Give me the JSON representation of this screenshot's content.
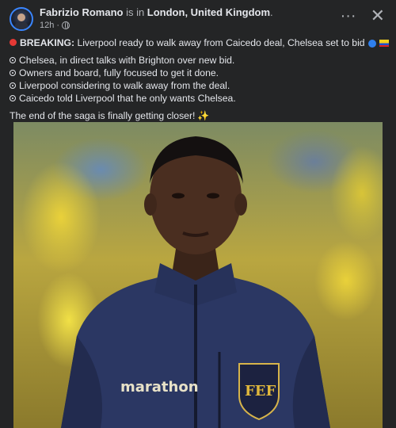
{
  "post": {
    "author": "Fabrizio Romano",
    "is_in": " is in ",
    "location": "London, United Kingdom",
    "period": ".",
    "time": "12h",
    "time_sep": "·",
    "more_label": "···",
    "close_label": "✕"
  },
  "body": {
    "breaking_label": "BREAKING:",
    "headline": " Liverpool ready to walk away from Caicedo deal, Chelsea set to bid",
    "bullets": [
      "Chelsea, in direct talks with Brighton over new bid.",
      "Owners and board, fully focused to get it done.",
      "Liverpool considering to walk away from the deal.",
      "Caicedo told Liverpool that he only wants Chelsea."
    ],
    "closing": "The end of the saga is finally getting closer!",
    "sparkle": "✨"
  },
  "photo": {
    "jacket_text": "marathon",
    "crest_text": "FEF"
  },
  "colors": {
    "background": "#242526",
    "text": "#e4e6eb",
    "muted": "#b0b3b8",
    "jacket": "#2b3763"
  }
}
